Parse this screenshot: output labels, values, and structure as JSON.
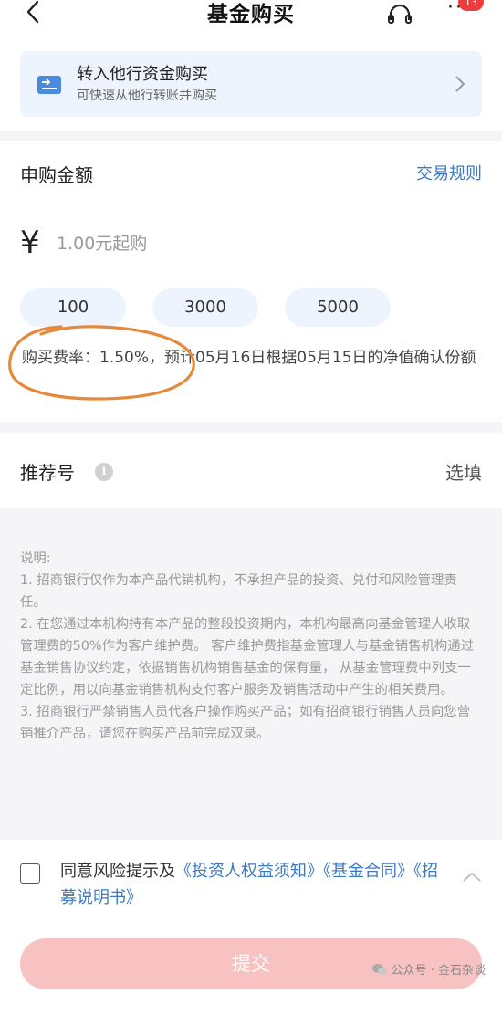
{
  "header": {
    "title": "基金购买",
    "badge_count": "13"
  },
  "transfer": {
    "title": "转入他行资金购买",
    "subtitle": "可快速从他行转账并购买"
  },
  "amount": {
    "label": "申购金额",
    "rules_link": "交易规则",
    "currency_symbol": "¥",
    "placeholder": "1.00元起购",
    "quick_amounts": [
      "100",
      "3000",
      "5000"
    ],
    "rate_text": "购买费率：1.50%，预计05月16日根据05月15日的净值确认份额"
  },
  "referral": {
    "label": "推荐号",
    "info_symbol": "i",
    "optional": "选填"
  },
  "notes": {
    "heading": "说明:",
    "items": [
      "1. 招商银行仅作为本产品代销机构，不承担产品的投资、兑付和风险管理责任。",
      "2. 在您通过本机构持有本产品的整段投资期内，本机构最高向基金管理人收取管理费的50%作为客户维护费。 客户维护费指基金管理人与基金销售机构通过基金销售协议约定，依据销售机构销售基金的保有量， 从基金管理费中列支一定比例，用以向基金销售机构支付客户服务及销售活动中产生的相关费用。",
      "3. 招商银行严禁销售人员代客户操作购买产品；如有招商银行销售人员向您营销推介产品，请您在购买产品前完成双录。"
    ]
  },
  "consent": {
    "prefix": "同意风险提示及",
    "doc1": "《投资人权益须知》",
    "doc2": "《基金合同》",
    "doc3": "《招募说明书》"
  },
  "submit_label": "提交",
  "watermark": "公众号 · 金石杂谈",
  "colors": {
    "accent": "#3b79c4",
    "submit_disabled": "#f8c2c2",
    "chip_bg": "#eef4fd",
    "badge": "#ef3b3b",
    "annotation": "#e58a3c"
  },
  "icons": [
    "back-arrow-icon",
    "headset-icon",
    "more-icon",
    "transfer-card-icon",
    "chevron-right-icon",
    "info-icon",
    "chevron-up-icon",
    "wechat-icon"
  ]
}
